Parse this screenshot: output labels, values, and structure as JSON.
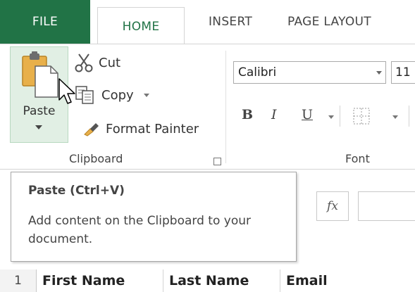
{
  "tabs": {
    "file": "FILE",
    "home": "HOME",
    "insert": "INSERT",
    "page_layout": "PAGE LAYOUT"
  },
  "clipboard": {
    "paste": "Paste",
    "cut": "Cut",
    "copy": "Copy",
    "format_painter": "Format Painter",
    "group_label": "Clipboard"
  },
  "font": {
    "name": "Calibri",
    "size": "11",
    "bold": "B",
    "italic": "I",
    "underline": "U",
    "group_label": "Font"
  },
  "formula_bar": {
    "fx": "fx"
  },
  "tooltip": {
    "title": "Paste (Ctrl+V)",
    "description": "Add content on the Clipboard to your document."
  },
  "sheet": {
    "row_number": "1",
    "cells": [
      "First Name",
      "Last Name",
      "Email"
    ]
  },
  "colors": {
    "accent": "#217346",
    "paste_highlight": "#e1efe4"
  }
}
